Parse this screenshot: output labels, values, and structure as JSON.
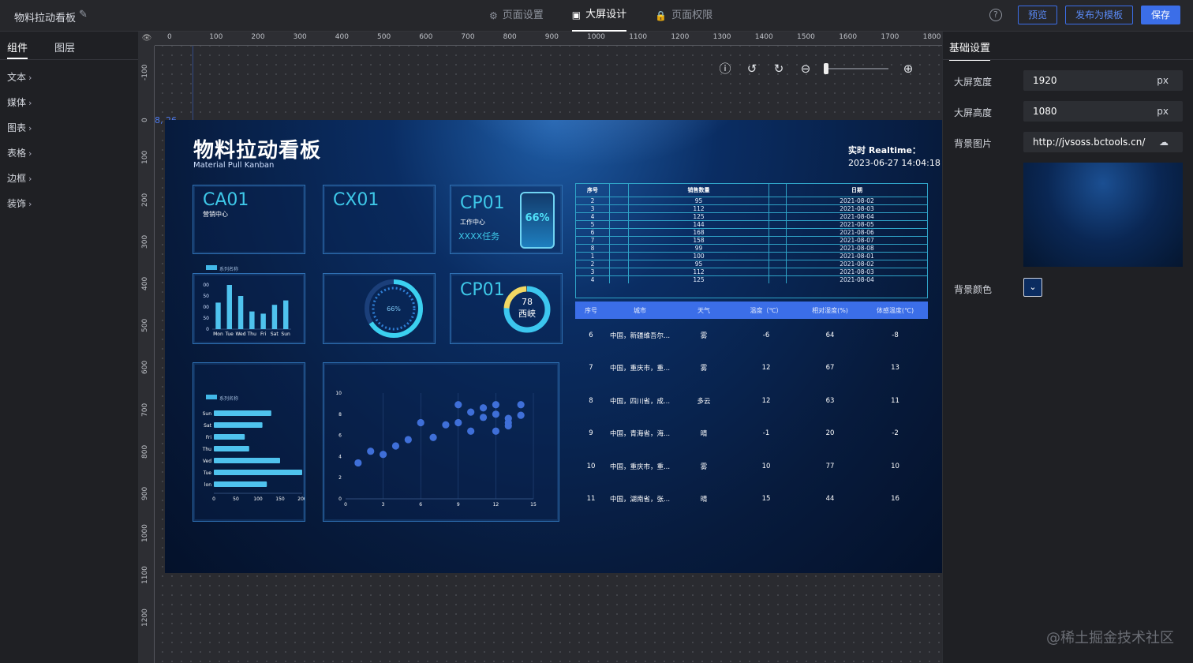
{
  "topbar": {
    "title": "物料拉动看板",
    "tabs": [
      {
        "icon": "gear-icon",
        "label": "页面设置"
      },
      {
        "icon": "screen-icon",
        "label": "大屏设计"
      },
      {
        "icon": "lock-icon",
        "label": "页面权限"
      }
    ],
    "preview": "预览",
    "publish": "发布为模板",
    "save": "保存"
  },
  "left": {
    "tabs": [
      "组件",
      "图层"
    ],
    "items": [
      "文本",
      "媒体",
      "图表",
      "表格",
      "边框",
      "装饰"
    ]
  },
  "rulers": {
    "top": [
      "0",
      "100",
      "200",
      "300",
      "400",
      "500",
      "600",
      "700",
      "800",
      "900",
      "1000",
      "1100",
      "1200",
      "1300",
      "1400",
      "1500",
      "1600",
      "1700",
      "1800"
    ],
    "left": [
      "-100",
      "0",
      "100",
      "200",
      "300",
      "400",
      "500",
      "600",
      "700",
      "800",
      "900",
      "1000",
      "1100",
      "1200"
    ]
  },
  "coord_text": "8, 26",
  "screen": {
    "title": "物料拉动看板",
    "subtitle": "Material Pull Kanban",
    "realtime_label": "实时 Realtime：",
    "datetime": "2023-06-27 14:04:18",
    "cards": {
      "ca": {
        "code": "CA01",
        "sub": "营销中心"
      },
      "cx": {
        "code": "CX01"
      },
      "cp": {
        "code": "CP01",
        "sub": "工作中心",
        "task": "XXXX任务",
        "percent": "66%"
      },
      "ring": {
        "percent": "66%"
      },
      "cp2": {
        "code": "CP01",
        "value": "78",
        "place": "西峡"
      }
    },
    "legend": "系列名称",
    "top_table": {
      "headers": [
        "序号",
        "销售数量",
        "日期"
      ],
      "rows": [
        [
          "2",
          "95",
          "2021-08-02"
        ],
        [
          "3",
          "112",
          "2021-08-03"
        ],
        [
          "4",
          "125",
          "2021-08-04"
        ],
        [
          "5",
          "144",
          "2021-08-05"
        ],
        [
          "6",
          "168",
          "2021-08-06"
        ],
        [
          "7",
          "158",
          "2021-08-07"
        ],
        [
          "8",
          "99",
          "2021-08-08"
        ],
        [
          "1",
          "100",
          "2021-08-01"
        ],
        [
          "2",
          "95",
          "2021-08-02"
        ],
        [
          "3",
          "112",
          "2021-08-03"
        ],
        [
          "4",
          "125",
          "2021-08-04"
        ]
      ]
    },
    "bottom_table": {
      "headers": [
        "序号",
        "城市",
        "天气",
        "温度（℃）",
        "相对湿度(%)",
        "体感温度(℃)"
      ],
      "rows": [
        [
          "6",
          "中国，新疆维吾尔...",
          "雾",
          "-6",
          "64",
          "-8"
        ],
        [
          "7",
          "中国，重庆市，重...",
          "雾",
          "12",
          "67",
          "13"
        ],
        [
          "8",
          "中国，四川省，成...",
          "多云",
          "12",
          "63",
          "11"
        ],
        [
          "9",
          "中国，青海省，海...",
          "晴",
          "-1",
          "20",
          "-2"
        ],
        [
          "10",
          "中国，重庆市，重...",
          "雾",
          "10",
          "77",
          "10"
        ],
        [
          "11",
          "中国，湖南省，张...",
          "晴",
          "15",
          "44",
          "16"
        ]
      ]
    }
  },
  "chart_data": [
    {
      "type": "bar",
      "categories": [
        "Mon",
        "Tue",
        "Wed",
        "Thu",
        "Fri",
        "Sat",
        "Sun"
      ],
      "values": [
        120,
        200,
        150,
        80,
        70,
        110,
        130
      ],
      "yticks": [
        "00",
        "50",
        "00",
        "50",
        "0"
      ],
      "legend": "系列名称"
    },
    {
      "type": "bar",
      "orientation": "horizontal",
      "categories": [
        "Mon",
        "Tue",
        "Wed",
        "Thu",
        "Fri",
        "Sat",
        "Sun"
      ],
      "category_labels": [
        "lon",
        "Tue",
        "Ved",
        "Thu",
        "Fri",
        "Sat",
        "Sun"
      ],
      "values": [
        120,
        200,
        150,
        80,
        70,
        110,
        130
      ],
      "xticks": [
        "0",
        "50",
        "100",
        "150",
        "200"
      ],
      "legend": "系列名称"
    },
    {
      "type": "scatter",
      "x": [
        1,
        2,
        3,
        4,
        5,
        6,
        7,
        8,
        9,
        9,
        10,
        10,
        11,
        11,
        12,
        12,
        12,
        13,
        13,
        13,
        14,
        14
      ],
      "y": [
        3.4,
        4.5,
        4.2,
        5,
        5.6,
        7.2,
        5.8,
        7,
        8.9,
        7.2,
        8.2,
        6.4,
        8.6,
        7.7,
        8.9,
        8,
        6.4,
        7.2,
        6.9,
        7.6,
        8.9,
        7.9
      ],
      "xticks": [
        "0",
        "3",
        "6",
        "9",
        "12",
        "15"
      ],
      "yticks": [
        "0",
        "2",
        "4",
        "6",
        "8",
        "10"
      ]
    }
  ],
  "right": {
    "tab": "基础设置",
    "width_label": "大屏宽度",
    "width_value": "1920",
    "width_unit": "px",
    "height_label": "大屏高度",
    "height_value": "1080",
    "height_unit": "px",
    "bg_image_label": "背景图片",
    "bg_image_value": "http://jvsoss.bctools.cn/",
    "bg_color_label": "背景颜色"
  },
  "watermark": "@稀土掘金技术社区"
}
